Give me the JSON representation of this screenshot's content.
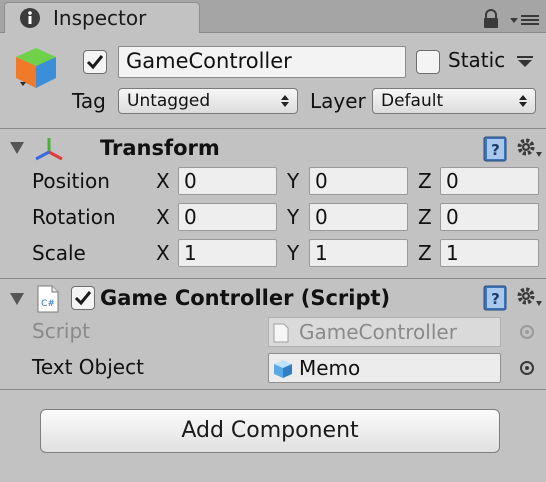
{
  "window": {
    "tab_title": "Inspector"
  },
  "header": {
    "active": true,
    "name": "GameController",
    "static_label": "Static",
    "static_checked": false,
    "tag_label": "Tag",
    "tag_value": "Untagged",
    "layer_label": "Layer",
    "layer_value": "Default"
  },
  "transform": {
    "title": "Transform",
    "rows": [
      {
        "label": "Position",
        "x": "0",
        "y": "0",
        "z": "0"
      },
      {
        "label": "Rotation",
        "x": "0",
        "y": "0",
        "z": "0"
      },
      {
        "label": "Scale",
        "x": "1",
        "y": "1",
        "z": "1"
      }
    ],
    "axis": {
      "x": "X",
      "y": "Y",
      "z": "Z"
    }
  },
  "script_component": {
    "title": "Game Controller (Script)",
    "enabled": true,
    "script_label": "Script",
    "script_value": "GameController",
    "text_object_label": "Text Object",
    "text_object_value": "Memo"
  },
  "add_component_label": "Add Component",
  "icons": {
    "tab": "info-icon",
    "lock": "lock-icon",
    "menu": "panel-menu-icon",
    "object": "gameobject-cube-icon",
    "transform": "transform-axes-icon",
    "script": "csharp-script-icon",
    "help": "help-book-icon",
    "settings": "gear-icon",
    "picker": "object-picker-icon"
  },
  "colors": {
    "accent_cube_top": "#6fd04a",
    "accent_cube_front": "#f07a2a",
    "accent_cube_side": "#3b8fd8"
  }
}
